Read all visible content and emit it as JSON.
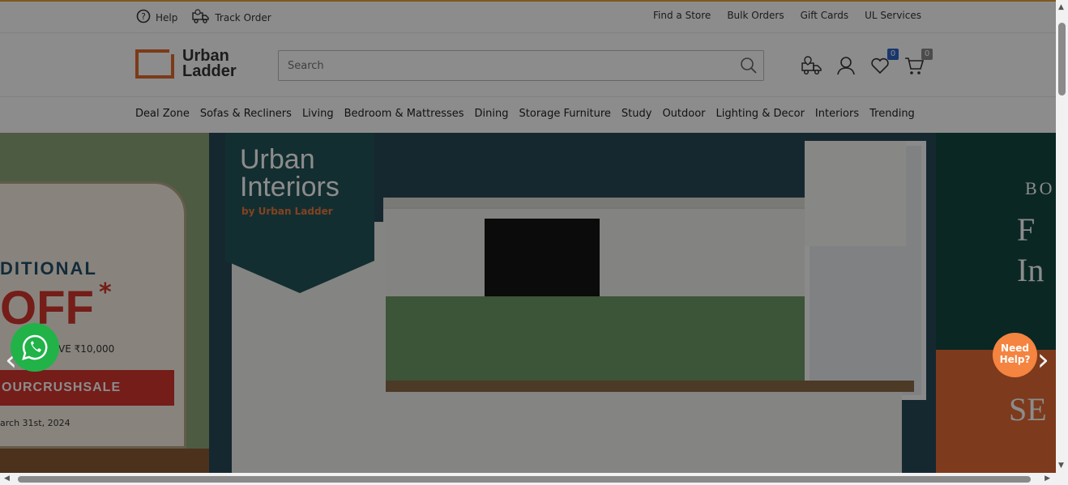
{
  "utility": {
    "help": "Help",
    "track_order": "Track Order",
    "links": [
      "Find a Store",
      "Bulk Orders",
      "Gift Cards",
      "UL Services"
    ]
  },
  "header": {
    "logo_line1": "Urban",
    "logo_line2": "Ladder",
    "search_placeholder": "Search",
    "wishlist_count": "0",
    "cart_count": "0",
    "brand_color": "#e26a2c"
  },
  "nav": {
    "items": [
      "Deal Zone",
      "Sofas & Recliners",
      "Living",
      "Bedroom & Mattresses",
      "Dining",
      "Storage Furniture",
      "Study",
      "Outdoor",
      "Lighting & Decor",
      "Interiors",
      "Trending"
    ]
  },
  "hero": {
    "left_slide": {
      "headline": "DITIONAL",
      "off": "OFF",
      "star": "*",
      "save": "VE ₹10,000",
      "code": "OURCRUSHSALE",
      "date": "arch 31st, 2024"
    },
    "main_slide": {
      "title": "Urban Interiors",
      "subtitle": "by Urban Ladder"
    },
    "right_slide": {
      "line1": "BO",
      "line2": "F",
      "line3": "In",
      "line4": "SE"
    }
  },
  "widgets": {
    "need_help": "Need Help?",
    "whatsapp": "whatsapp-icon"
  }
}
